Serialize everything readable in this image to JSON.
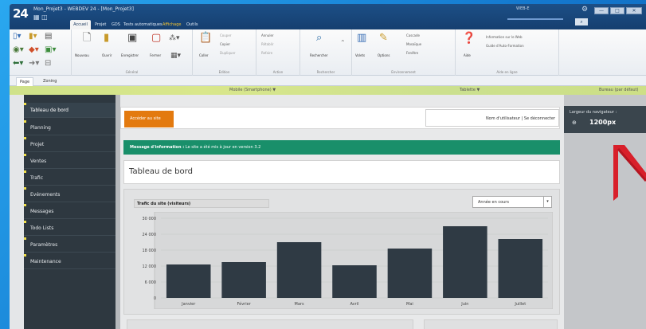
{
  "titlebar": {
    "app_logo": "24",
    "title": "Mon_Projet3 - WEBDEV 24 - [Mon_Projet3]",
    "menu_tabs": [
      "Accueil",
      "Projet",
      "GDS",
      "Tests automatiques",
      "Affichage",
      "Outils"
    ],
    "center_text": "WEB-E",
    "window_buttons": [
      "—",
      "□",
      "✕"
    ]
  },
  "ribbon": {
    "groups": [
      {
        "label": "Général",
        "items": [
          "Nouveau",
          "Ouvrir",
          "Enregistrer",
          "Fermer"
        ]
      },
      {
        "label": "Edition",
        "items": [
          "Coller",
          "Couper",
          "Copier",
          "Dupliquer"
        ]
      },
      {
        "label": "Action",
        "items": [
          "Annuler",
          "Rétablir",
          "Refaire"
        ]
      },
      {
        "label": "Rechercher",
        "items": [
          "Rechercher"
        ]
      },
      {
        "label": "Environnement",
        "items": [
          "Volets",
          "Options",
          "Cascade",
          "Mosaïque",
          "Fenêtre"
        ]
      },
      {
        "label": "Aide en ligne",
        "items": [
          "Aide",
          "Information sur le Web",
          "Guide d'Auto-Formation"
        ]
      }
    ]
  },
  "page_tabs": [
    "Page",
    "Zoning"
  ],
  "ruler": {
    "mobile": "Mobile (Smartphone) ▼",
    "tablet": "Tablette ▼",
    "desktop": "Bureau (par défaut)"
  },
  "sidebar": {
    "items": [
      "Tableau de bord",
      "Planning",
      "Projet",
      "Ventes",
      "Trafic",
      "Evénements",
      "Messages",
      "Todo Lists",
      "Paramètres",
      "Maintenance"
    ],
    "active_index": 0
  },
  "header": {
    "site_button": "Accéder au site",
    "user_links": "Nom d'utilisateur | Se déconnecter"
  },
  "info": {
    "prefix": "Message d'information :",
    "message": "Le site a été mis à jour en version 3.2"
  },
  "page_title": "Tableau de bord",
  "chart_panel": {
    "title": "Trafic du site (visiteurs)",
    "period": "Année en cours"
  },
  "right_panel": {
    "label": "Largeur du navigateur :",
    "value": "1200px"
  },
  "colors": {
    "accent_orange": "#e37a0f",
    "info_green": "#198f6a",
    "sidebar": "#2e3840",
    "bar": "#2f3a44"
  },
  "chart_data": {
    "type": "bar",
    "title": "Trafic du site (visiteurs)",
    "categories": [
      "Janvier",
      "Février",
      "Mars",
      "Avril",
      "Mai",
      "Juin",
      "Juillet"
    ],
    "values": [
      12600,
      13500,
      21000,
      12300,
      18600,
      27000,
      22200
    ],
    "yticks": [
      "30 000",
      "24 000",
      "18 000",
      "12 000",
      "6 000",
      "0"
    ],
    "ylim": [
      0,
      30000
    ],
    "grid": true
  }
}
